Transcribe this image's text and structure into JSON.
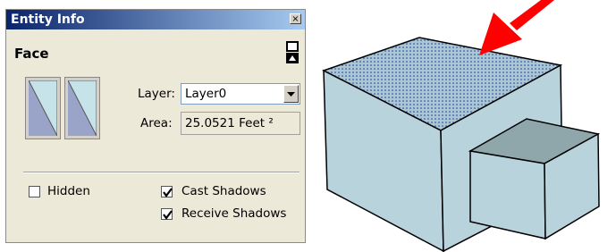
{
  "window": {
    "title": "Entity Info",
    "close_glyph": "×"
  },
  "panel": {
    "heading": "Face",
    "layer_label": "Layer:",
    "layer_value": "Layer0",
    "area_label": "Area:",
    "area_value": "25.0521 Feet ²"
  },
  "options": {
    "hidden": {
      "label": "Hidden",
      "checked": false
    },
    "cast_shadows": {
      "label": "Cast Shadows",
      "checked": true
    },
    "receive_shadows": {
      "label": "Receive Shadows",
      "checked": true
    }
  },
  "colors": {
    "title_bar_start": "#0a246a",
    "title_bar_end": "#a6caf0",
    "panel_bg": "#ece9d8",
    "cube_face": "#b9d3dc",
    "selected_face": "#a9c6d4",
    "selection_dots": "#2a3a9a",
    "arrow": "#ff0000"
  },
  "icons": {
    "close": "close-icon",
    "collapse": "collapse-icon",
    "dropdown": "chevron-down-icon",
    "front_material": "material-swatch-icon",
    "back_material": "material-swatch-icon",
    "pointer": "red-arrow-icon"
  }
}
